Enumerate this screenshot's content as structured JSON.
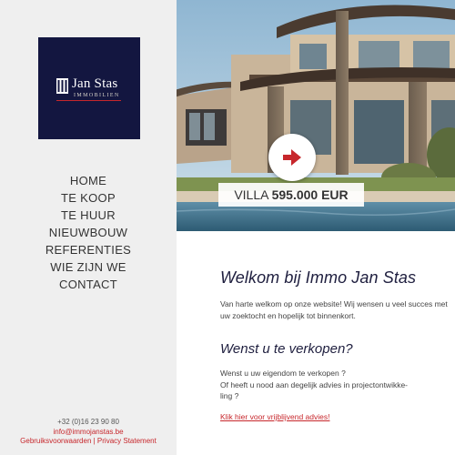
{
  "logo": {
    "name": "Jan Stas",
    "subtitle": "IMMOBILIEN"
  },
  "nav": {
    "items": [
      "HOME",
      "TE KOOP",
      "TE HUUR",
      "NIEUWBOUW",
      "REFERENTIES",
      "WIE ZIJN WE",
      "CONTACT"
    ]
  },
  "contact": {
    "phone": "+32 (0)16 23 90 80",
    "email": "info@immojanstas.be",
    "links": "Gebruiksvoorwaarden | Privacy Statement"
  },
  "hero": {
    "price_prefix": "VILLA",
    "price_amount": "595.000 EUR",
    "button_icon": "arrow-right-icon"
  },
  "welcome": {
    "title": "Welkom bij Immo Jan Stas",
    "text": "Van harte welkom op onze website! Wij wensen u veel succes met uw zoektocht en hopelijk tot binnenkort."
  },
  "sell": {
    "title": "Wenst u te verkopen?",
    "line1": "Wenst u uw eigendom te verkopen ?",
    "line2": "Of heeft u nood aan degelijk advies in projectontwikke-",
    "line3": "ling ?",
    "link": "Klik hier voor vrijblijvend advies!"
  },
  "colors": {
    "logo_bg": "#131640",
    "accent": "#c7272c",
    "heading": "#1f1f3f",
    "sidebar_bg": "#efefef"
  }
}
